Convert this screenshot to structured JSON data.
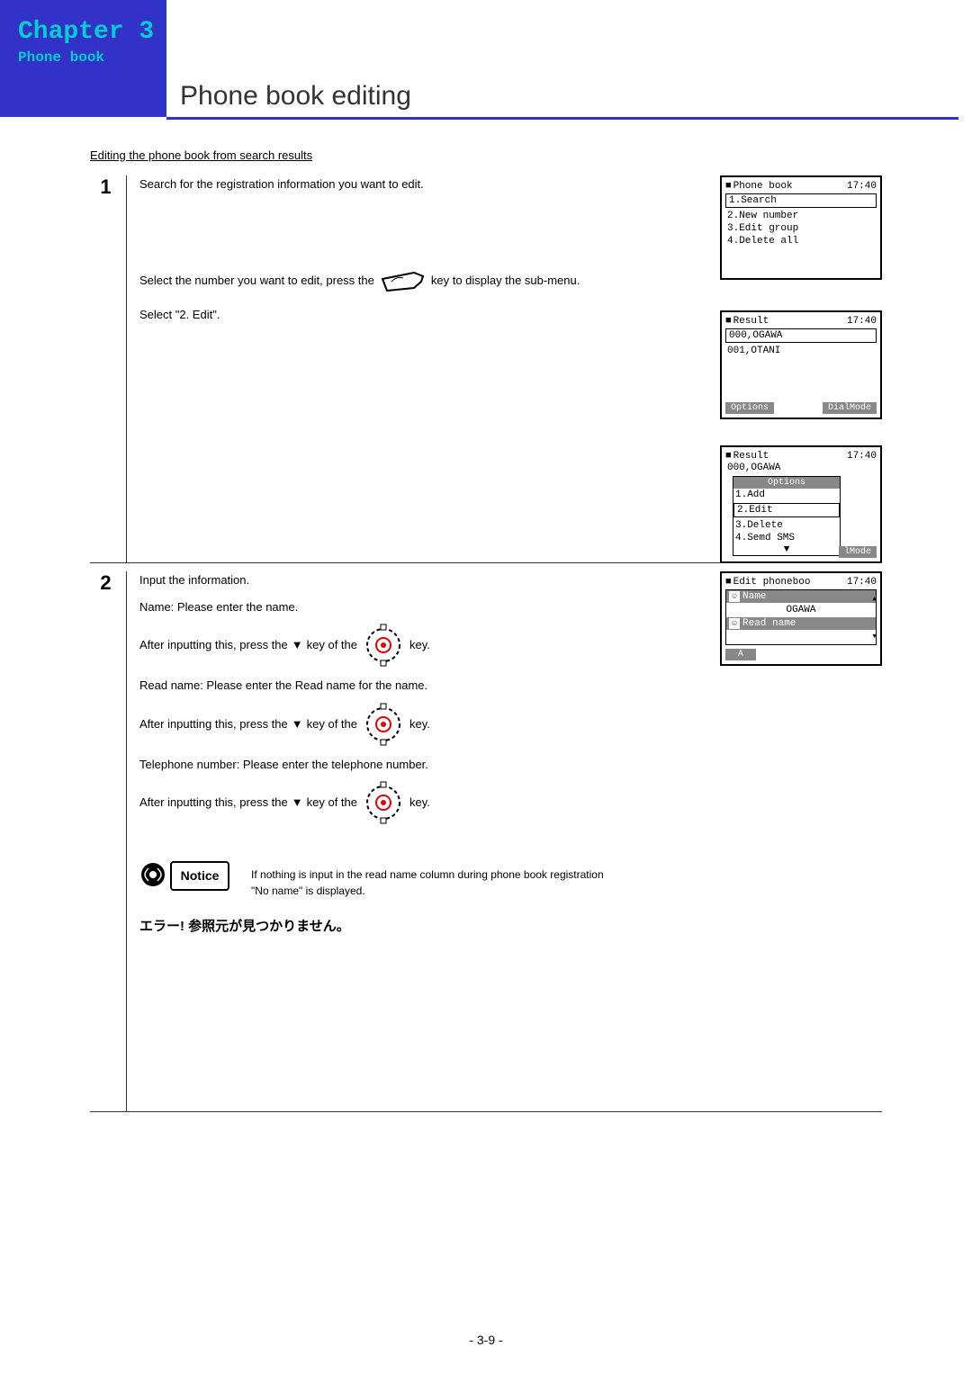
{
  "sidebar": {
    "chapter": "Chapter 3",
    "sub": "Phone book"
  },
  "title": "Phone book editing",
  "intro": "Editing the phone book from search results",
  "step1": {
    "num": "1",
    "line1": "Search for the registration information you want to edit.",
    "line2a": "Select the number you want to edit, press the",
    "line2b": "key to display the sub-menu.",
    "line3": "Select \"2. Edit\"."
  },
  "step2": {
    "num": "2",
    "line1": "Input the information.",
    "line2": "Name:  Please enter the name.",
    "line3a": "After inputting this, press the",
    "line3b": " key of the",
    "line3c": "key.",
    "line4": "Read name:  Please enter the Read name for the name.",
    "line5a": "After inputting this, press the",
    "line5b": " key of the",
    "line5c": "key.",
    "line6": "Telephone number:  Please enter the telephone number.",
    "line7a": "After inputting this, press the",
    "line7b": " key of the",
    "line7c": "key."
  },
  "notice": {
    "label": "Notice",
    "text1": "If nothing is input in the read name column during phone book registration",
    "text2": " \"No name\" is displayed."
  },
  "error": "エラー! 参照元が見つかりません。",
  "screens": {
    "s1": {
      "title": "Phone book",
      "time": "17:40",
      "i1": "1.Search",
      "i2": "2.New number",
      "i3": "3.Edit group",
      "i4": "4.Delete all"
    },
    "s2": {
      "title": "Result",
      "time": "17:40",
      "i1": "000,OGAWA",
      "i2": "001,OTANI",
      "b1": "Options",
      "b2": "DialMode"
    },
    "s3": {
      "title": "Result",
      "time": "17:40",
      "i1": "000,OGAWA",
      "opt": "Options",
      "m1": "1.Add",
      "m2": "2.Edit",
      "m3": "3.Delete",
      "m4": "4.Semd SMS",
      "b2": "lMode"
    },
    "s4": {
      "title": "Edit phoneboo",
      "time": "17:40",
      "f1": "Name",
      "v1": "OGAWA",
      "f2": "Read name",
      "b1": "A"
    }
  },
  "pagenum": "- 3-9 -"
}
